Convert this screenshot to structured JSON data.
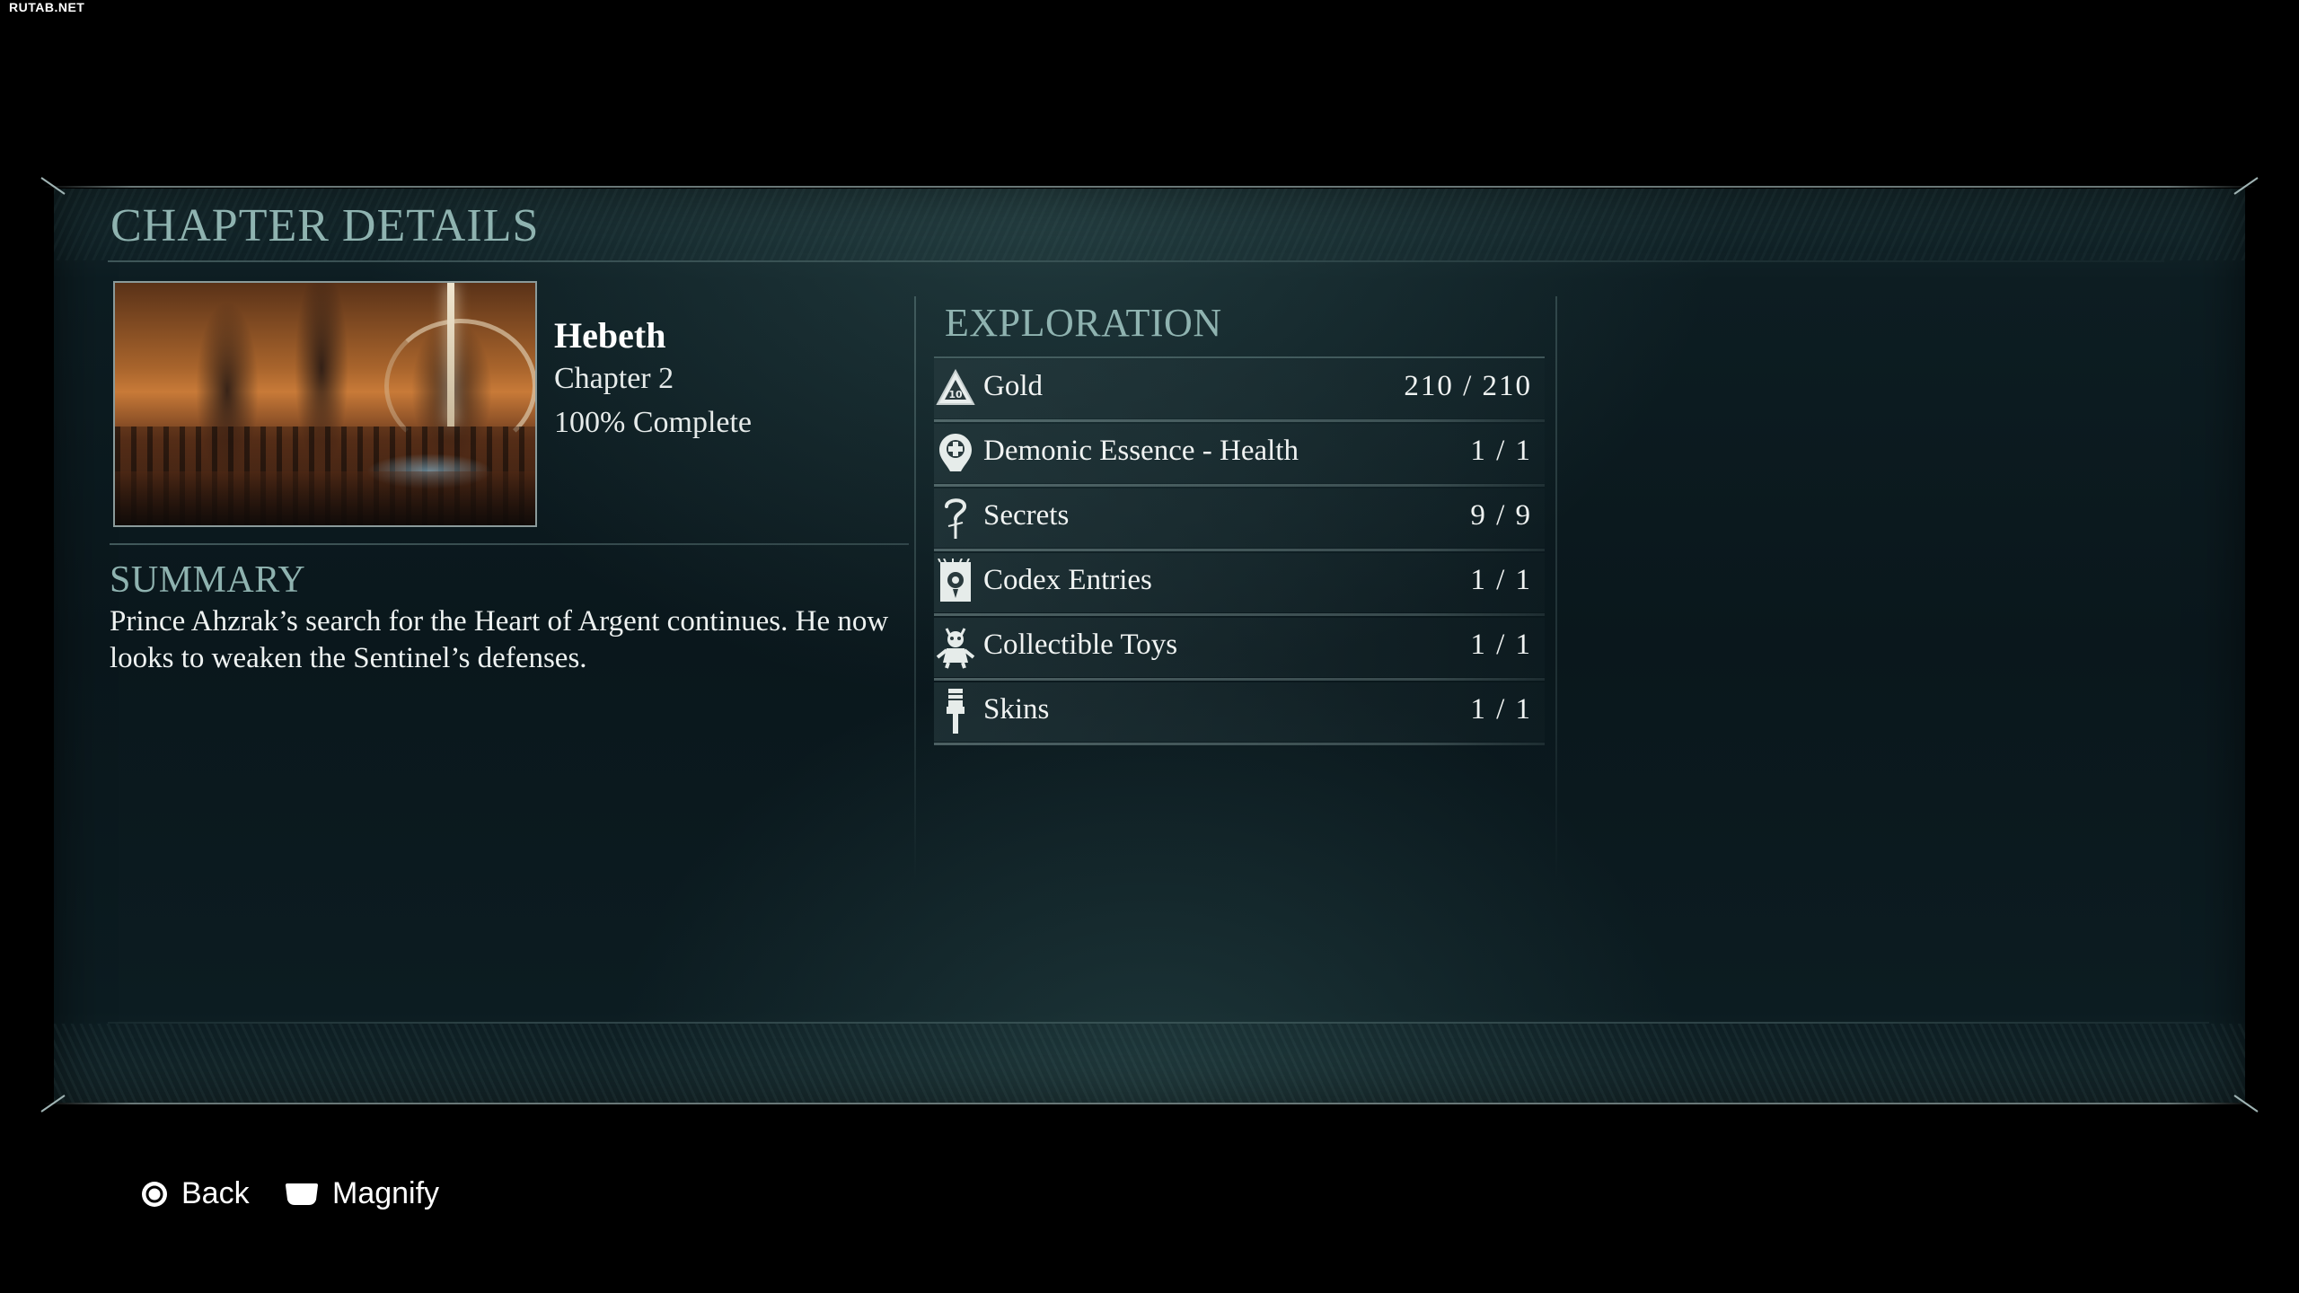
{
  "watermark": "RUTAB.NET",
  "screen": {
    "title": "CHAPTER DETAILS"
  },
  "chapter": {
    "name": "Hebeth",
    "number_label": "Chapter 2",
    "completion_label": "100% Complete"
  },
  "summary": {
    "title": "SUMMARY",
    "text": "Prince Ahzrak’s search for the Heart of Argent continues. He now looks to weaken the Sentinel’s defenses."
  },
  "exploration": {
    "title": "EXPLORATION",
    "items": [
      {
        "label": "Gold",
        "value": "210 / 210",
        "icon": "gold-icon"
      },
      {
        "label": "Demonic Essence - Health",
        "value": "1 / 1",
        "icon": "demonic-essence-icon"
      },
      {
        "label": "Secrets",
        "value": "9 / 9",
        "icon": "secrets-icon"
      },
      {
        "label": "Codex Entries",
        "value": "1 / 1",
        "icon": "codex-icon"
      },
      {
        "label": "Collectible Toys",
        "value": "1 / 1",
        "icon": "toy-icon"
      },
      {
        "label": "Skins",
        "value": "1 / 1",
        "icon": "skin-brush-icon"
      }
    ]
  },
  "prompts": {
    "back_label": "Back",
    "magnify_label": "Magnify"
  },
  "colors": {
    "accent_heading": "#8fb3b0",
    "panel_bg": "#0a171c",
    "text": "#f0f3f2"
  }
}
